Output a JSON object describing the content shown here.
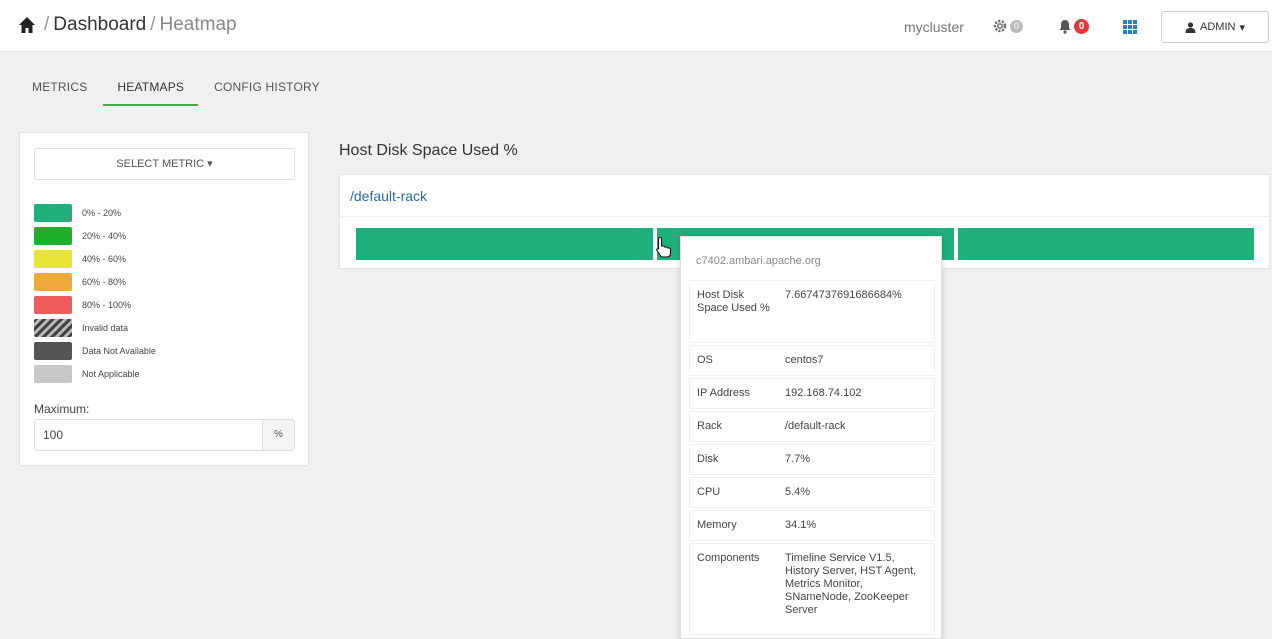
{
  "header": {
    "home_icon": "home-icon",
    "breadcrumb": [
      "Dashboard",
      "Heatmap"
    ],
    "separator": "/",
    "cluster_name": "mycluster",
    "services_badge": "0",
    "alerts_badge": "0",
    "apps_icon": "grid-icon",
    "user_menu_label": "ADMIN"
  },
  "tabs": [
    {
      "label": "METRICS",
      "active": false
    },
    {
      "label": "HEATMAPS",
      "active": true
    },
    {
      "label": "CONFIG HISTORY",
      "active": false
    }
  ],
  "sidebar": {
    "select_metric_label": "SELECT METRIC",
    "legend": [
      {
        "label": "0% - 20%",
        "color": "#1db07a"
      },
      {
        "label": "20% - 40%",
        "color": "#1fae2a"
      },
      {
        "label": "40% - 60%",
        "color": "#e8e436"
      },
      {
        "label": "60% - 80%",
        "color": "#efa83a"
      },
      {
        "label": "80% - 100%",
        "color": "#ee5b5b"
      },
      {
        "label": "Invalid data",
        "color": "hatched"
      },
      {
        "label": "Data Not Available",
        "color": "#555555"
      },
      {
        "label": "Not Applicable",
        "color": "#c8c8c8"
      }
    ],
    "maximum_label": "Maximum:",
    "maximum_value": "100",
    "maximum_unit": "%"
  },
  "heatmap": {
    "title": "Host Disk Space Used %",
    "rack": "/default-rack",
    "host_color": "#1db07a",
    "host_count": 3
  },
  "tooltip": {
    "host": "c7402.ambari.apache.org",
    "rows": [
      {
        "key": "Host Disk Space Used %",
        "value": "7.6674737691686684%"
      },
      {
        "key": "OS",
        "value": "centos7"
      },
      {
        "key": "IP Address",
        "value": "192.168.74.102"
      },
      {
        "key": "Rack",
        "value": "/default-rack"
      },
      {
        "key": "Disk",
        "value": "7.7%"
      },
      {
        "key": "CPU",
        "value": "5.4%"
      },
      {
        "key": "Memory",
        "value": "34.1%"
      },
      {
        "key": "Components",
        "value": "Timeline Service V1.5, History Server, HST Agent, Metrics Monitor, SNameNode, ZooKeeper Server"
      }
    ]
  }
}
